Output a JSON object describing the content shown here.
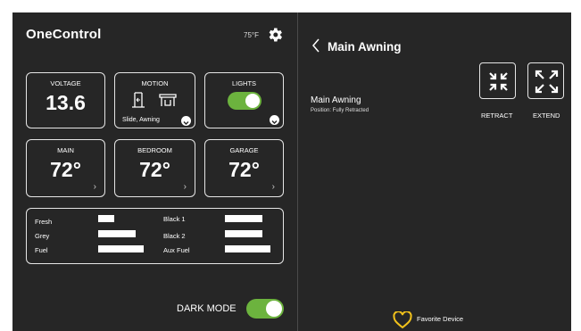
{
  "header": {
    "logo": "OneControl",
    "temperature": "75°F",
    "settings_icon": "gear-icon"
  },
  "tiles": {
    "voltage": {
      "label": "VOLTAGE",
      "value": "13.6"
    },
    "motion": {
      "label": "MOTION",
      "subtitle": "Slide, Awning",
      "icons": [
        "slide-icon",
        "awning-icon"
      ]
    },
    "lights": {
      "label": "LIGHTS",
      "on": true
    },
    "main": {
      "label": "MAIN",
      "value": "72°"
    },
    "bedroom": {
      "label": "BEDROOM",
      "value": "72°"
    },
    "garage": {
      "label": "GARAGE",
      "value": "72°"
    }
  },
  "tanks": [
    {
      "label": "Fresh",
      "level": 0.3
    },
    {
      "label": "Grey",
      "level": 0.7
    },
    {
      "label": "Fuel",
      "level": 0.85
    },
    {
      "label": "Black 1",
      "level": 0.7
    },
    {
      "label": "Black 2",
      "level": 0.7
    },
    {
      "label": "Aux Fuel",
      "level": 0.85
    }
  ],
  "dark_mode": {
    "label": "DARK MODE",
    "on": true
  },
  "detail": {
    "title": "Main Awning",
    "device_name": "Main Awning",
    "position": "Position: Fully Retracted",
    "retract_label": "RETRACT",
    "extend_label": "EXTEND",
    "favorite_label": "Favorite Device"
  },
  "colors": {
    "background": "#262626",
    "accent_green": "#6cb33e",
    "favorite_yellow": "#f2c21b"
  }
}
